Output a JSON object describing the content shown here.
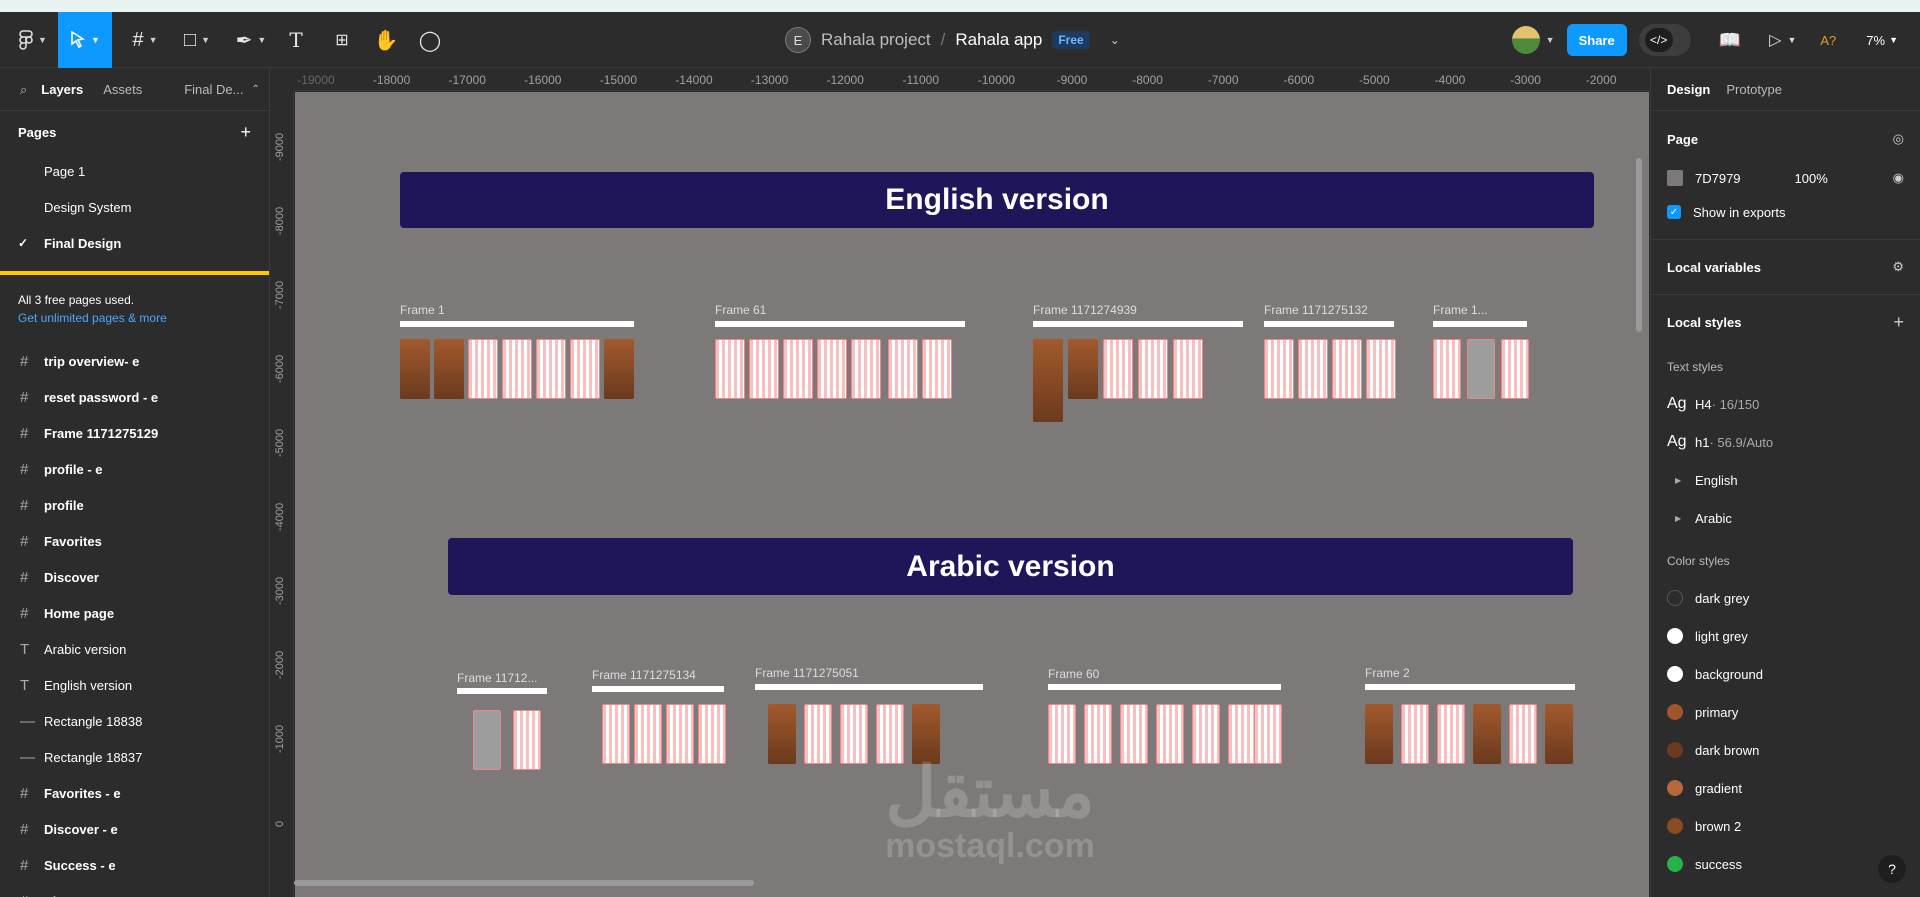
{
  "toolbar": {
    "project": "Rahala project",
    "separator": "/",
    "file": "Rahala app",
    "plan_badge": "Free",
    "avatar_letter": "E",
    "share": "Share",
    "code": "</>",
    "zoom": "7%",
    "ai_label": "A?"
  },
  "left": {
    "tabs": [
      "Layers",
      "Assets",
      "Final De..."
    ],
    "pages_title": "Pages",
    "pages": [
      "Page 1",
      "Design System",
      "Final Design"
    ],
    "notice_text": "All 3 free pages used.",
    "notice_link": "Get unlimited pages & more",
    "layers": [
      {
        "name": "trip overview- e",
        "type": "frame"
      },
      {
        "name": "reset password - e",
        "type": "frame"
      },
      {
        "name": "Frame 1171275129",
        "type": "frame"
      },
      {
        "name": "profile - e",
        "type": "frame"
      },
      {
        "name": "profile",
        "type": "frame"
      },
      {
        "name": "Favorites",
        "type": "frame"
      },
      {
        "name": "Discover",
        "type": "frame"
      },
      {
        "name": "Home page",
        "type": "frame"
      },
      {
        "name": "Arabic version",
        "type": "text"
      },
      {
        "name": "English version",
        "type": "text"
      },
      {
        "name": "Rectangle 18838",
        "type": "line"
      },
      {
        "name": "Rectangle 18837",
        "type": "line"
      },
      {
        "name": "Favorites - e",
        "type": "frame"
      },
      {
        "name": "Discover - e",
        "type": "frame"
      },
      {
        "name": "Success - e",
        "type": "frame"
      },
      {
        "name": "Sign Up - e",
        "type": "frame"
      }
    ]
  },
  "ruler": {
    "x_ticks": [
      "-19000",
      "-18000",
      "-17000",
      "-16000",
      "-15000",
      "-14000",
      "-13000",
      "-12000",
      "-11000",
      "-10000",
      "-9000",
      "-8000",
      "-7000",
      "-6000",
      "-5000",
      "-4000",
      "-3000",
      "-2000"
    ],
    "y_ticks": [
      "-9000",
      "-8000",
      "-7000",
      "-6000",
      "-5000",
      "-4000",
      "-3000",
      "-2000",
      "-1000",
      "0"
    ]
  },
  "canvas": {
    "bg": "#7d7979",
    "banner_en": "English version",
    "banner_ar": "Arabic version",
    "frame_labels": [
      "Frame 1",
      "Frame 61",
      "Frame 1171274939",
      "Frame 1171275132",
      "Frame 1...",
      "Frame 11712...",
      "Frame 1171275134",
      "Frame 1171275051",
      "Frame 60",
      "Frame 2"
    ],
    "watermark_ar": "مستقل",
    "watermark_en": "mostaql.com"
  },
  "right": {
    "tabs": [
      "Design",
      "Prototype"
    ],
    "page_label": "Page",
    "page_color": "7D7979",
    "page_opacity": "100%",
    "show_exports": "Show in exports",
    "local_variables": "Local variables",
    "local_styles": "Local styles",
    "text_styles_label": "Text styles",
    "text_styles": [
      {
        "prefix": "Ag",
        "name": "H4",
        "meta": " · 16/150"
      },
      {
        "prefix": "Ag",
        "name": "h1",
        "meta": " · 56.9/Auto"
      }
    ],
    "groups": [
      "English",
      "Arabic"
    ],
    "color_styles_label": "Color styles",
    "colors": [
      {
        "name": "dark grey",
        "hex": "#2c2c2c"
      },
      {
        "name": "light grey",
        "hex": "#ffffff"
      },
      {
        "name": "background",
        "hex": "#ffffff"
      },
      {
        "name": "primary",
        "hex": "#a0562b"
      },
      {
        "name": "dark brown",
        "hex": "#6b3a20"
      },
      {
        "name": "gradient",
        "hex": "#b8683a"
      },
      {
        "name": "brown 2",
        "hex": "#8a4a24"
      },
      {
        "name": "success",
        "hex": "#27b24a"
      }
    ],
    "help": "?"
  }
}
